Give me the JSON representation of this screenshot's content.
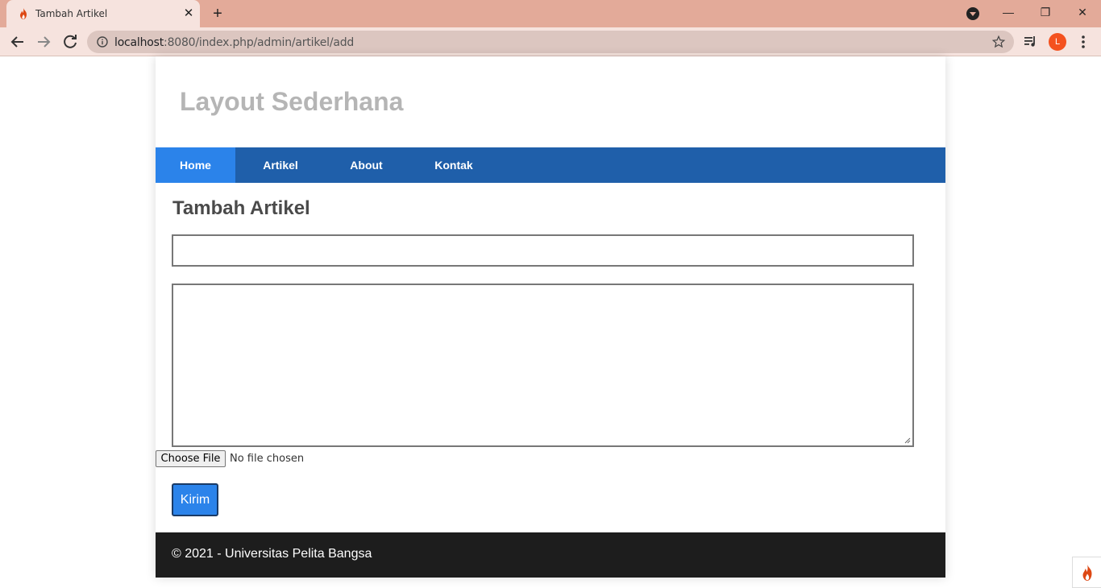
{
  "browser": {
    "tab_title": "Tambah Artikel",
    "tab_close": "✕",
    "new_tab": "+",
    "url_host": "localhost",
    "url_rest": ":8080/index.php/admin/artikel/add",
    "avatar_letter": "L",
    "window_buttons": {
      "minimize": "—",
      "maximize": "❐",
      "close": "✕"
    }
  },
  "site": {
    "title": "Layout Sederhana",
    "nav": [
      {
        "label": "Home",
        "active": true
      },
      {
        "label": "Artikel",
        "active": false
      },
      {
        "label": "About",
        "active": false
      },
      {
        "label": "Kontak",
        "active": false
      }
    ]
  },
  "form": {
    "heading": "Tambah Artikel",
    "title_value": "",
    "body_value": "",
    "file_button": "Choose File",
    "file_status": "No file chosen",
    "submit_label": "Kirim"
  },
  "footer": {
    "text": "© 2021 - Universitas Pelita Bangsa"
  },
  "colors": {
    "navbar": "#1f5faa",
    "nav_active": "#2b83ea",
    "submit": "#2b83ea",
    "footer": "#1d1d1d",
    "site_title": "#b5b5b5",
    "codeigniter_flame": "#dd4814"
  }
}
